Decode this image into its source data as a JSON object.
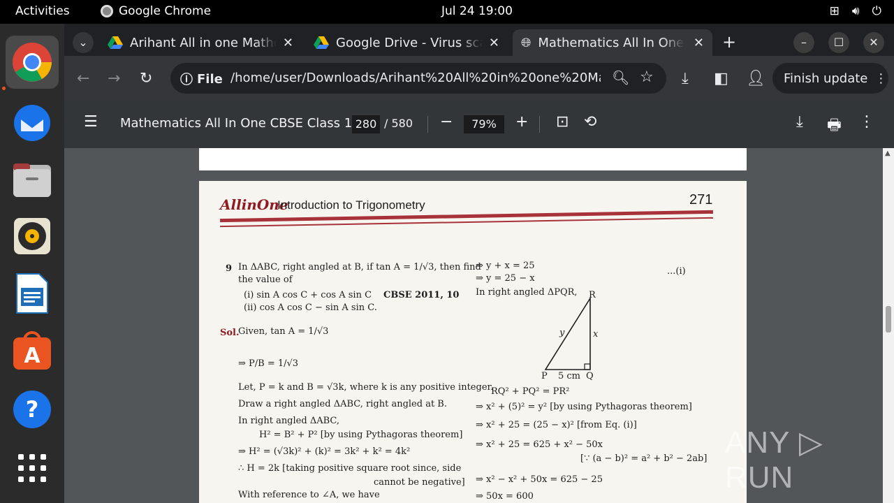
{
  "topbar": {
    "activities": "Activities",
    "app_name": "Google Chrome",
    "clock": "Jul 24  19:00"
  },
  "dock": {
    "items": [
      "chrome",
      "thunderbird",
      "files",
      "rhythmbox",
      "writer",
      "app-center",
      "help",
      "app-grid"
    ]
  },
  "tabs": [
    {
      "title": "Arihant All in one Mathe",
      "icon": "google-drive-icon"
    },
    {
      "title": "Google Drive - Virus scar",
      "icon": "google-drive-icon"
    },
    {
      "title": "Mathematics All In One (",
      "icon": "globe-icon",
      "active": true
    }
  ],
  "toolbar": {
    "file_label": "File",
    "url": "/home/user/Downloads/Arihant%20All%20in%20one%20Mathe...",
    "finish_update": "Finish update"
  },
  "pdf": {
    "title": "Mathematics All In One CBSE Class 1...",
    "page_current": "280",
    "page_total": "/ 580",
    "zoom": "79%"
  },
  "page": {
    "brand": "AllinOne",
    "chapter": "Introduction to Trigonometry",
    "page_number": "271",
    "q_num": "9",
    "q_line1": "In ΔABC, right angled at B, if tan A = 1/√3, then find",
    "q_line2": "the value of",
    "q_i": "(i)  sin A cos C + cos A sin C",
    "q_ref": "CBSE 2011, 10",
    "q_ii": "(ii)  cos A cos C − sin A sin C.",
    "sol_label": "Sol.",
    "sol_given": "Given,   tan A = 1/√3",
    "sol_pb": "⇒          P/B = 1/√3",
    "sol_let": "Let,  P = k and B = √3k, where k is any positive integer.",
    "sol_draw": "Draw a right angled ΔABC, right angled at B.",
    "sol_in": "In right angled ΔABC,",
    "sol_h1": "H² = B² + P²      [by using Pythagoras  theorem]",
    "sol_h2": "⇒    H² = (√3k)² + (k)² = 3k² + k² = 4k²",
    "sol_h3": "∴      H = 2k       [taking positive square root since, side",
    "sol_h3b": "cannot be negative]",
    "sol_ref": "With reference to ∠A, we have",
    "r1": "⇒          y + x = 25",
    "r2": "⇒               y = 25 − x",
    "r2_tag": "...(i)",
    "r3": "In right angled ΔPQR,",
    "tri_R": "R",
    "tri_P": "P",
    "tri_Q": "Q",
    "tri_y": "y",
    "tri_x": "x",
    "tri_5": "5 cm",
    "r4": "RQ² + PQ² = PR²",
    "r5": "⇒      x² + (5)² = y²        [by using Pythagoras theorem]",
    "r6": "⇒       x² + 25 = (25 − x)²                  [from Eq. (i)]",
    "r7": "⇒       x² + 25 = 625 + x² − 50x",
    "r7b": "[∵ (a − b)² = a² + b² − 2ab]",
    "r8": "⇒  x² − x² + 50x = 625 − 25",
    "r9": "⇒              50x = 600"
  },
  "watermark": "ANY ▷ RUN"
}
